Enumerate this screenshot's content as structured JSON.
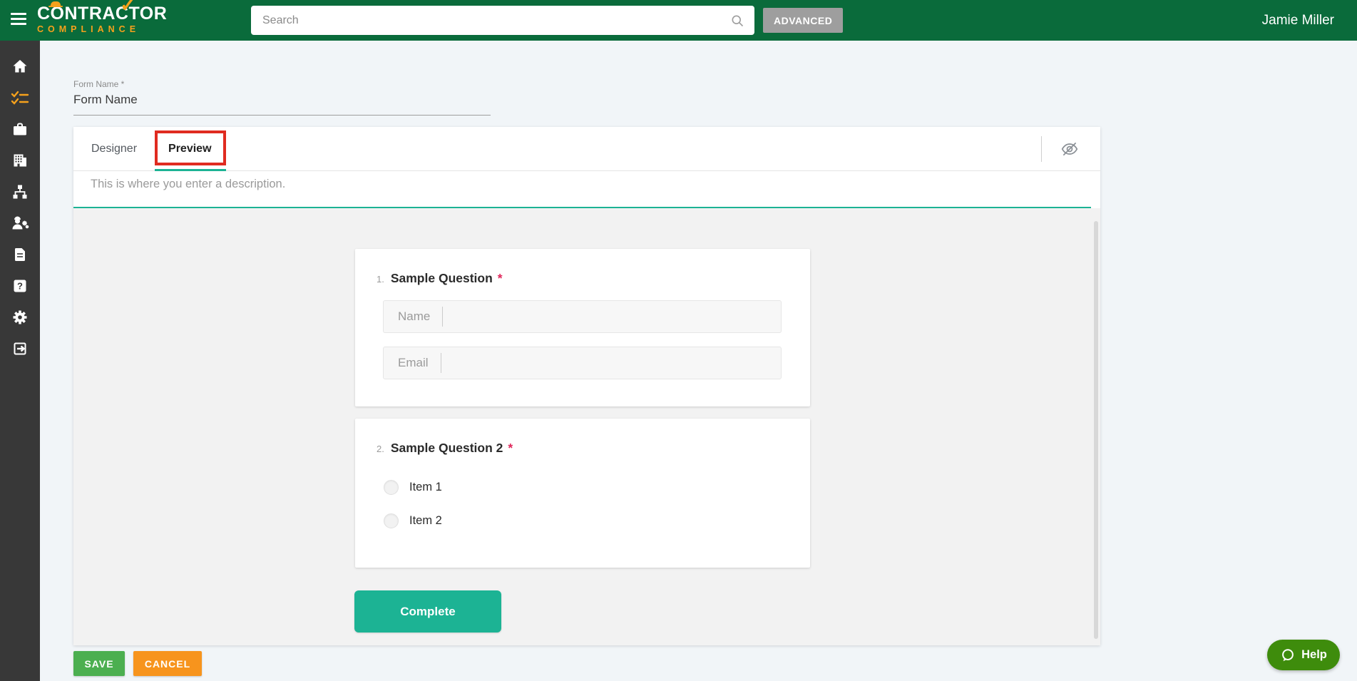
{
  "header": {
    "logo": {
      "line1": "CONTRACTOR",
      "line2": "COMPLIANCE"
    },
    "search": {
      "placeholder": "Search"
    },
    "advanced_label": "ADVANCED",
    "user_name": "Jamie Miller"
  },
  "sidebar": {
    "items": [
      {
        "icon": "home-icon",
        "active": false
      },
      {
        "icon": "checklist-icon",
        "active": true
      },
      {
        "icon": "briefcase-icon",
        "active": false
      },
      {
        "icon": "building-icon",
        "active": false
      },
      {
        "icon": "org-chart-icon",
        "active": false
      },
      {
        "icon": "worker-settings-icon",
        "active": false
      },
      {
        "icon": "document-icon",
        "active": false
      },
      {
        "icon": "help-icon",
        "active": false
      },
      {
        "icon": "settings-gear-icon",
        "active": false
      },
      {
        "icon": "logout-icon",
        "active": false
      }
    ]
  },
  "form": {
    "name_label": "Form Name *",
    "name_value": "Form Name",
    "tabs": {
      "designer": "Designer",
      "preview": "Preview"
    },
    "active_tab": "Preview",
    "description": "This is where you enter a description."
  },
  "preview_pane": {
    "questions": [
      {
        "number": "1.",
        "title": "Sample Question",
        "required_marker": "*",
        "inputs": [
          {
            "label": "Name"
          },
          {
            "label": "Email"
          }
        ]
      },
      {
        "number": "2.",
        "title": "Sample Question 2",
        "required_marker": "*",
        "options": [
          {
            "label": "Item 1"
          },
          {
            "label": "Item 2"
          }
        ]
      }
    ],
    "complete_button": "Complete"
  },
  "actions": {
    "save": "SAVE",
    "cancel": "CANCEL"
  },
  "help_widget": {
    "label": "Help"
  },
  "colors": {
    "header_green": "#0a6b3b",
    "sidebar_dark": "#383838",
    "accent_orange": "#f5a11c",
    "teal": "#1cb394",
    "annotation_red": "#e02b20",
    "required_red": "#e0285c",
    "save_green": "#4caf50",
    "cancel_orange": "#f7941d",
    "help_green": "#3e8c0c",
    "page_bg": "#f1f5f8"
  }
}
